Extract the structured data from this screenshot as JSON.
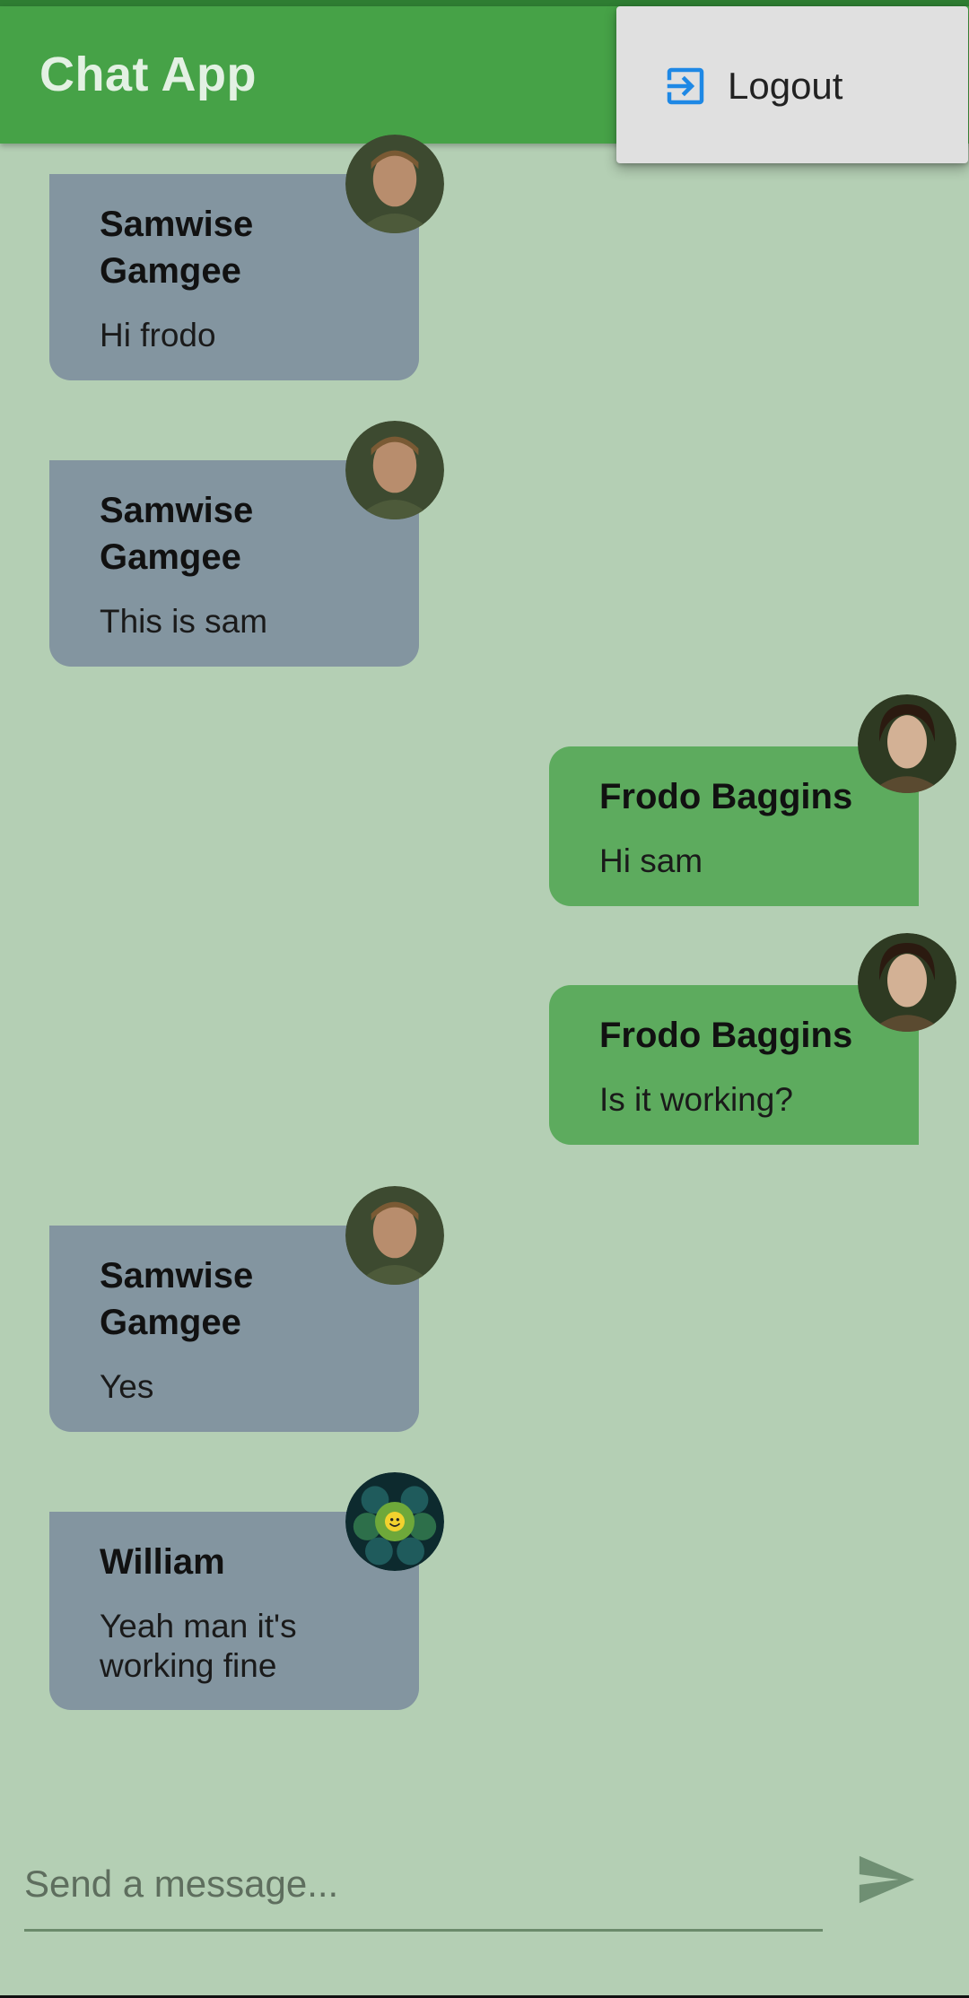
{
  "app": {
    "title": "Chat App"
  },
  "menu": {
    "logout_label": "Logout",
    "logout_icon": "logout-icon"
  },
  "messages": [
    {
      "sender": "Samwise Gamgee",
      "text": "Hi frodo",
      "avatar": "samwise-avatar",
      "side": "other"
    },
    {
      "sender": "Samwise Gamgee",
      "text": "This is sam",
      "avatar": "samwise-avatar",
      "side": "other"
    },
    {
      "sender": "Frodo Baggins",
      "text": "Hi sam",
      "avatar": "frodo-avatar",
      "side": "self"
    },
    {
      "sender": "Frodo Baggins",
      "text": "Is it working?",
      "avatar": "frodo-avatar",
      "side": "self"
    },
    {
      "sender": "Samwise Gamgee",
      "text": "Yes",
      "avatar": "samwise-avatar",
      "side": "other"
    },
    {
      "sender": "William",
      "text": "Yeah man it's working fine",
      "avatar": "william-avatar",
      "side": "other"
    }
  ],
  "composer": {
    "placeholder": "Send a message...",
    "send_icon": "send-icon"
  },
  "colors": {
    "background": "#b4cfb4",
    "app_bar": "#46a247",
    "bubble_other": "#8395a0",
    "bubble_self": "#5dab5e",
    "menu": "#e0e0e0",
    "logout_icon": "#1e88e5"
  }
}
